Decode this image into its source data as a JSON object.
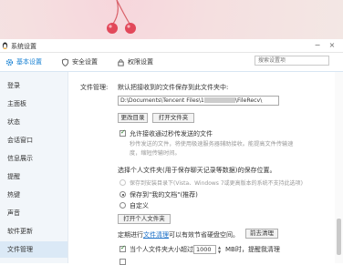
{
  "window": {
    "title": "系统设置"
  },
  "tabs": [
    {
      "label": "基本设置",
      "icon": "gear-icon"
    },
    {
      "label": "安全设置",
      "icon": "shield-icon"
    },
    {
      "label": "权限设置",
      "icon": "lock-icon"
    }
  ],
  "search": {
    "placeholder": "搜索设置项"
  },
  "sidebar": {
    "items": [
      {
        "label": "登录"
      },
      {
        "label": "主面板"
      },
      {
        "label": "状态"
      },
      {
        "label": "会话窗口"
      },
      {
        "label": "信息展示"
      },
      {
        "label": "提醒"
      },
      {
        "label": "热键"
      },
      {
        "label": "声音"
      },
      {
        "label": "软件更新"
      },
      {
        "label": "文件管理"
      }
    ],
    "active": "文件管理"
  },
  "file_mgmt": {
    "section_label": "文件管理:",
    "default_save_text": "默认把接收到的文件保存到此文件夹中:",
    "path_prefix": "D:\\Documents\\Tencent Files\\1",
    "path_suffix": "\\FileRecv\\",
    "change_dir_button": "更改目录",
    "open_folder_button": "打开文件夹",
    "allow_offline_label": "允许接收通过秒传发送的文件",
    "offline_desc_1": "秒传发送的文件，将使用极速服务器辅助接收。能提高文件传输速",
    "offline_desc_2": "度，缩短传输时间。",
    "personal_folder_title": "选择个人文件夹(用于保存聊天记录等数据)的保存位置。",
    "radio_installdir": "保存到安装目录下(Vista、Windows 7或更高版本的系统不支持此选项)",
    "radio_mydocs": "保存到\"我的文档\"(推荐)",
    "radio_custom": "自定义",
    "open_personal_button": "打开个人文件夹",
    "cleanup_prefix": "定期进行",
    "cleanup_link": "文件清理",
    "cleanup_suffix": "可以有效节省硬盘空间。",
    "cleanup_button": "前去清理",
    "size_prefix": "当个人文件夹大小超过",
    "size_value": "1000",
    "size_suffix": "MB时，提醒我清理"
  },
  "colors": {
    "accent": "#1a82d3",
    "sidebar_bg": "#f2f6fa",
    "sidebar_active": "#dbe9f6"
  }
}
